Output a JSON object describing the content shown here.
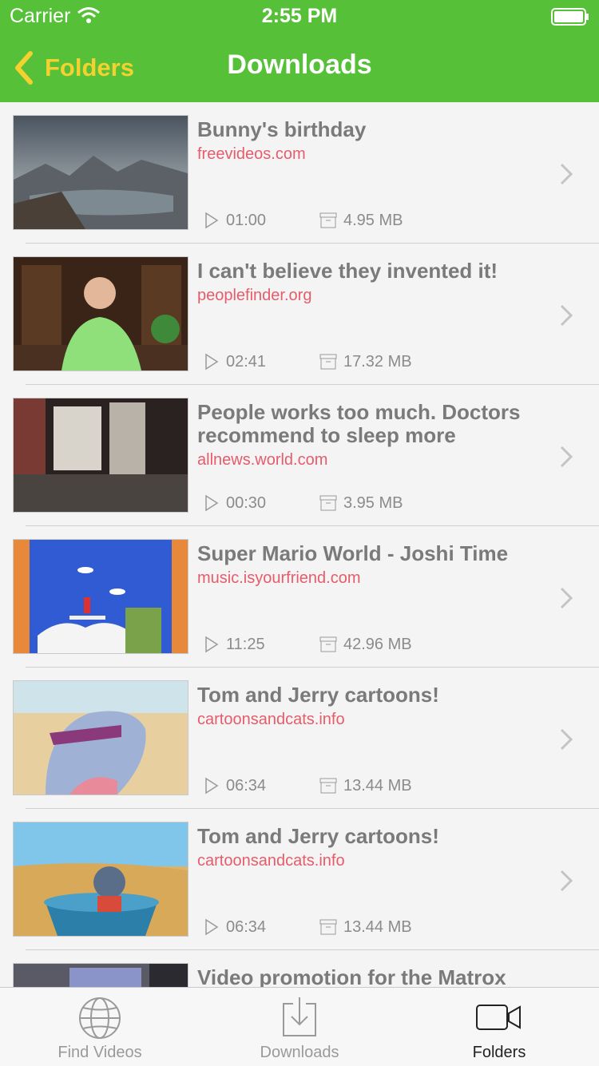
{
  "status_bar": {
    "carrier": "Carrier",
    "time": "2:55 PM"
  },
  "nav": {
    "back_label": "Folders",
    "title": "Downloads"
  },
  "colors": {
    "accent_green": "#56c038",
    "back_yellow": "#f4d12e",
    "source_red": "#e65c6b"
  },
  "items": [
    {
      "title": "Bunny's birthday",
      "source": "freevideos.com",
      "duration": "01:00",
      "size": "4.95 MB"
    },
    {
      "title": "I can't believe they invented it!",
      "source": "peoplefinder.org",
      "duration": "02:41",
      "size": "17.32 MB"
    },
    {
      "title": "People works too much. Doctors recommend to sleep more",
      "source": "allnews.world.com",
      "duration": "00:30",
      "size": "3.95 MB"
    },
    {
      "title": "Super Mario World - Joshi Time",
      "source": "music.isyourfriend.com",
      "duration": "11:25",
      "size": "42.96 MB"
    },
    {
      "title": "Tom and Jerry cartoons!",
      "source": "cartoonsandcats.info",
      "duration": "06:34",
      "size": "13.44 MB"
    },
    {
      "title": "Tom and Jerry cartoons!",
      "source": "cartoonsandcats.info",
      "duration": "06:34",
      "size": "13.44 MB"
    },
    {
      "title": "Video promotion for the Matrox"
    }
  ],
  "tabs": [
    {
      "label": "Find Videos",
      "icon": "globe-icon"
    },
    {
      "label": "Downloads",
      "icon": "download-icon"
    },
    {
      "label": "Folders",
      "icon": "video-camera-icon",
      "active": true
    }
  ]
}
